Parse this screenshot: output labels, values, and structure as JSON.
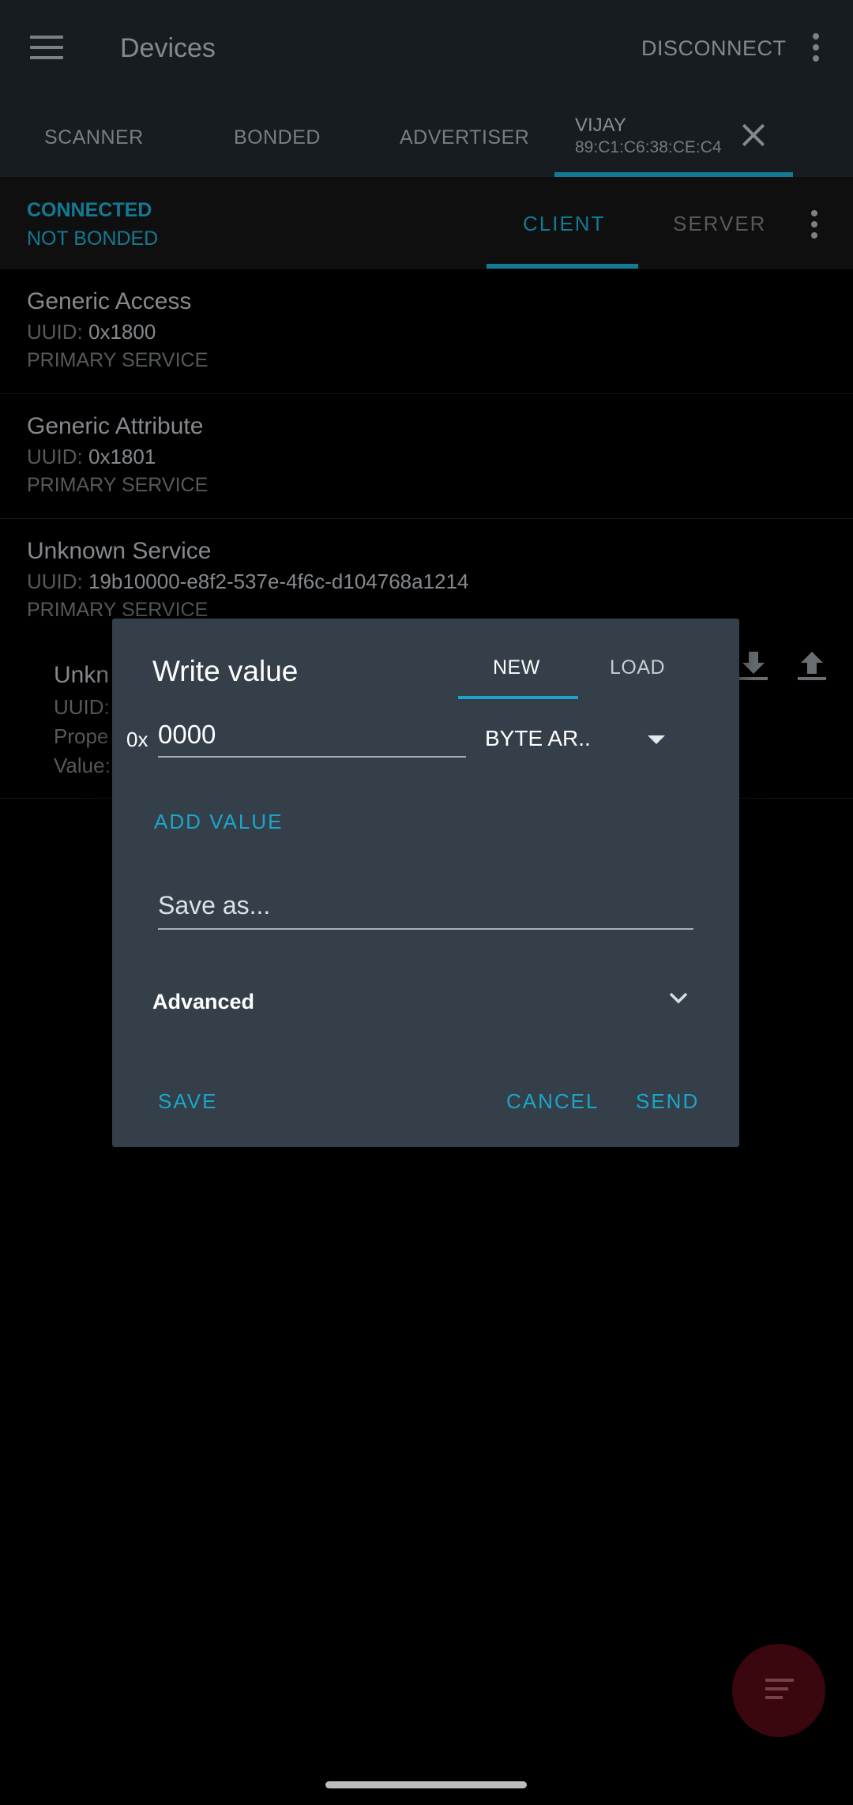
{
  "appbar": {
    "title": "Devices",
    "disconnect_label": "DISCONNECT"
  },
  "tabs": {
    "scanner": "SCANNER",
    "bonded": "BONDED",
    "advertiser": "ADVERTISER",
    "device_name": "VIJAY",
    "device_mac": "89:C1:C6:38:CE:C4"
  },
  "status": {
    "connection": "CONNECTED",
    "bond": "NOT BONDED",
    "client_tab": "CLIENT",
    "server_tab": "SERVER"
  },
  "services": [
    {
      "name": "Generic Access",
      "uuid_label": "UUID:",
      "uuid": "0x1800",
      "type": "PRIMARY SERVICE"
    },
    {
      "name": "Generic Attribute",
      "uuid_label": "UUID:",
      "uuid": "0x1801",
      "type": "PRIMARY SERVICE"
    },
    {
      "name": "Unknown Service",
      "uuid_label": "UUID:",
      "uuid": "19b10000-e8f2-537e-4f6c-d104768a1214",
      "type": "PRIMARY SERVICE"
    }
  ],
  "characteristic": {
    "name": "Unkn",
    "uuid_label": "UUID:",
    "properties_label": "Prope",
    "value_label": "Value:"
  },
  "dialog": {
    "title": "Write value",
    "tab_new": "NEW",
    "tab_load": "LOAD",
    "hex_prefix": "0x",
    "value": "0000",
    "type_selected": "BYTE AR..",
    "add_value": "ADD VALUE",
    "save_as_placeholder": "Save as...",
    "advanced_label": "Advanced",
    "save_button": "SAVE",
    "cancel_button": "CANCEL",
    "send_button": "SEND"
  },
  "colors": {
    "accent": "#1aa6c9",
    "dialog_bg": "#343f4a",
    "dim_accent": "#137a94",
    "fab": "#3a070e"
  },
  "icons": [
    "menu-icon",
    "overflow-menu-icon",
    "close-icon",
    "download-icon",
    "upload-icon",
    "dropdown-caret-icon",
    "chevron-down-icon",
    "log-list-icon"
  ]
}
